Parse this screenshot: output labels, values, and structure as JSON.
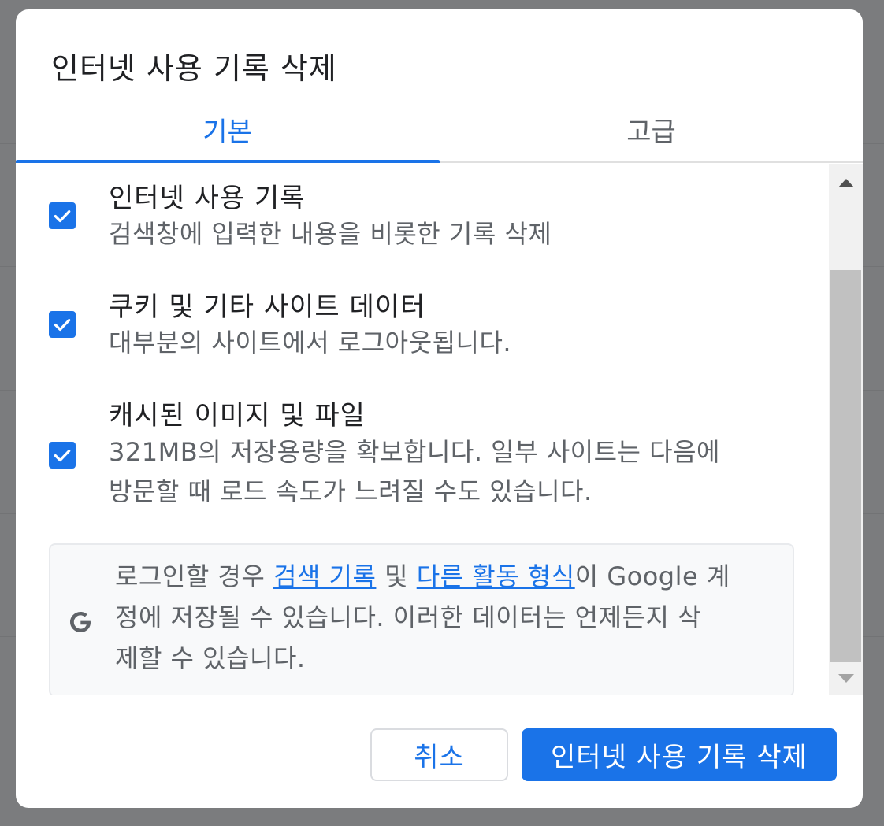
{
  "dialog": {
    "title": "인터넷 사용 기록 삭제"
  },
  "tabs": [
    {
      "label": "기본",
      "selected": true
    },
    {
      "label": "고급",
      "selected": false
    }
  ],
  "options": [
    {
      "title": "인터넷 사용 기록",
      "description": "검색창에 입력한 내용을 비롯한 기록 삭제",
      "checked": true
    },
    {
      "title": "쿠키 및 기타 사이트 데이터",
      "description": "대부분의 사이트에서 로그아웃됩니다.",
      "checked": true
    },
    {
      "title": "캐시된 이미지 및 파일",
      "description_line1": "321MB의 저장용량을 확보합니다. 일부 사이트는 다음에",
      "description_line2": "방문할 때 로드 속도가 느려질 수도 있습니다.",
      "checked": true
    }
  ],
  "info": {
    "icon": "google-g-icon",
    "part1": "로그인할 경우 ",
    "link1": "검색 기록",
    "part2": " 및 ",
    "link2": "다른 활동 형식",
    "part3": "이 Google 계",
    "line2": "정에 저장될 수 있습니다. 이러한 데이터는 언제든지 삭",
    "line3": "제할 수 있습니다."
  },
  "buttons": {
    "cancel": "취소",
    "delete": "인터넷 사용 기록 삭제"
  },
  "colors": {
    "accent": "#1a73e8",
    "text_primary": "#202124",
    "text_secondary": "#5f6368"
  }
}
